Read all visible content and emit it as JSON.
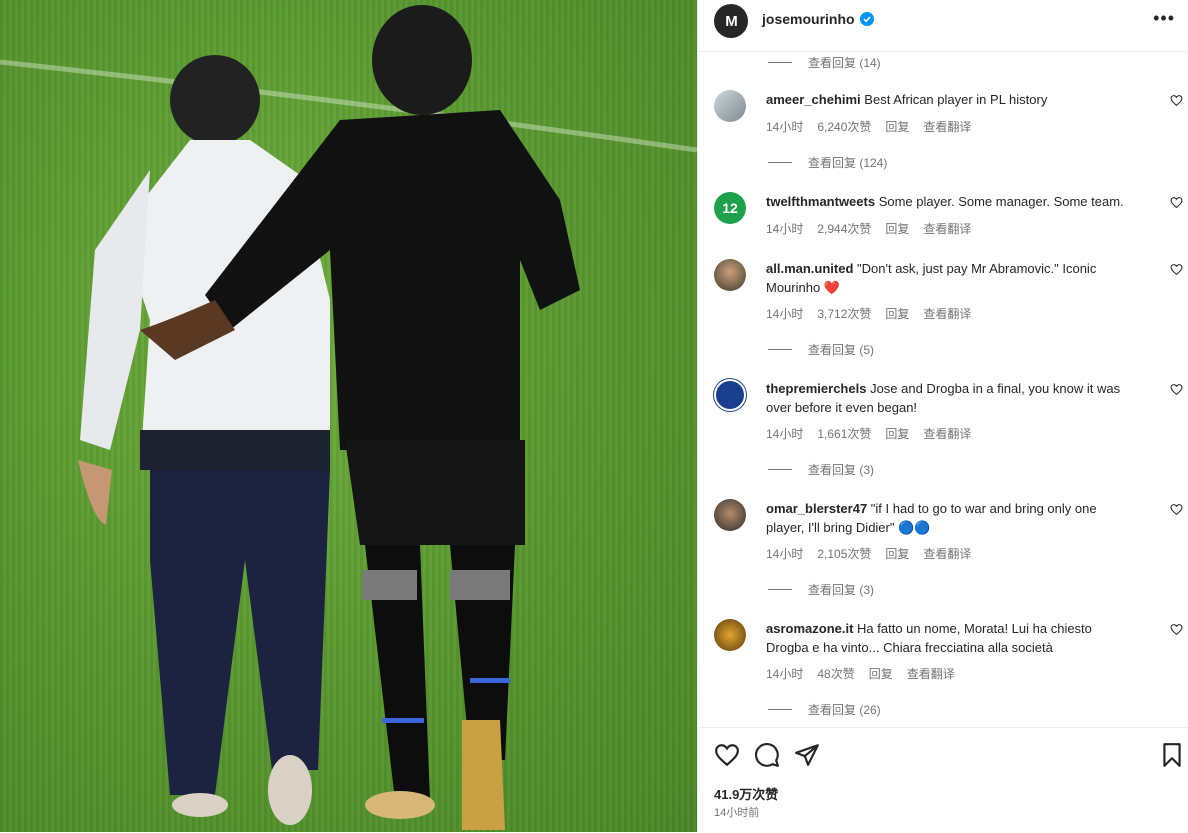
{
  "post": {
    "username": "josemourinho",
    "logo_text": "M",
    "more_icon": "more-horizontal-icon",
    "likes": "41.9万次赞",
    "time": "14小时前"
  },
  "top_replies": "查看回复 (14)",
  "comments": [
    {
      "user": "ameer_chehimi",
      "text": "Best African player in PL history",
      "time": "14小时",
      "likes": "6,240次赞",
      "reply": "回复",
      "translate": "查看翻译",
      "replies": "查看回复 (124)"
    },
    {
      "user": "twelfthmantweets",
      "text": "Some player. Some manager. Some team.",
      "time": "14小时",
      "likes": "2,944次赞",
      "reply": "回复",
      "translate": "查看翻译",
      "replies": ""
    },
    {
      "user": "all.man.united",
      "text": "\"Don't ask, just pay Mr Abramovic.\" Iconic Mourinho",
      "emoji": "❤️",
      "time": "14小时",
      "likes": "3,712次赞",
      "reply": "回复",
      "translate": "查看翻译",
      "replies": "查看回复 (5)"
    },
    {
      "user": "thepremierchels",
      "text": "Jose and Drogba in a final, you know it was over before it even began!",
      "time": "14小时",
      "likes": "1,661次赞",
      "reply": "回复",
      "translate": "查看翻译",
      "replies": "查看回复 (3)"
    },
    {
      "user": "omar_blerster47",
      "text": "\"if I had to go to war and bring only one player, I'll bring Didier\"",
      "emoji": "🔵🔵",
      "time": "14小时",
      "likes": "2,105次赞",
      "reply": "回复",
      "translate": "查看翻译",
      "replies": "查看回复 (3)"
    },
    {
      "user": "asromazone.it",
      "text": "Ha fatto un nome, Morata! Lui ha chiesto Drogba e ha vinto... Chiara frecciatina alla società",
      "time": "14小时",
      "likes": "48次赞",
      "reply": "回复",
      "translate": "查看翻译",
      "replies": "查看回复 (26)"
    }
  ],
  "colors": {
    "verified": "#0095f6",
    "muted": "#737373",
    "text": "#262626",
    "heart_red": "#ed4956"
  }
}
